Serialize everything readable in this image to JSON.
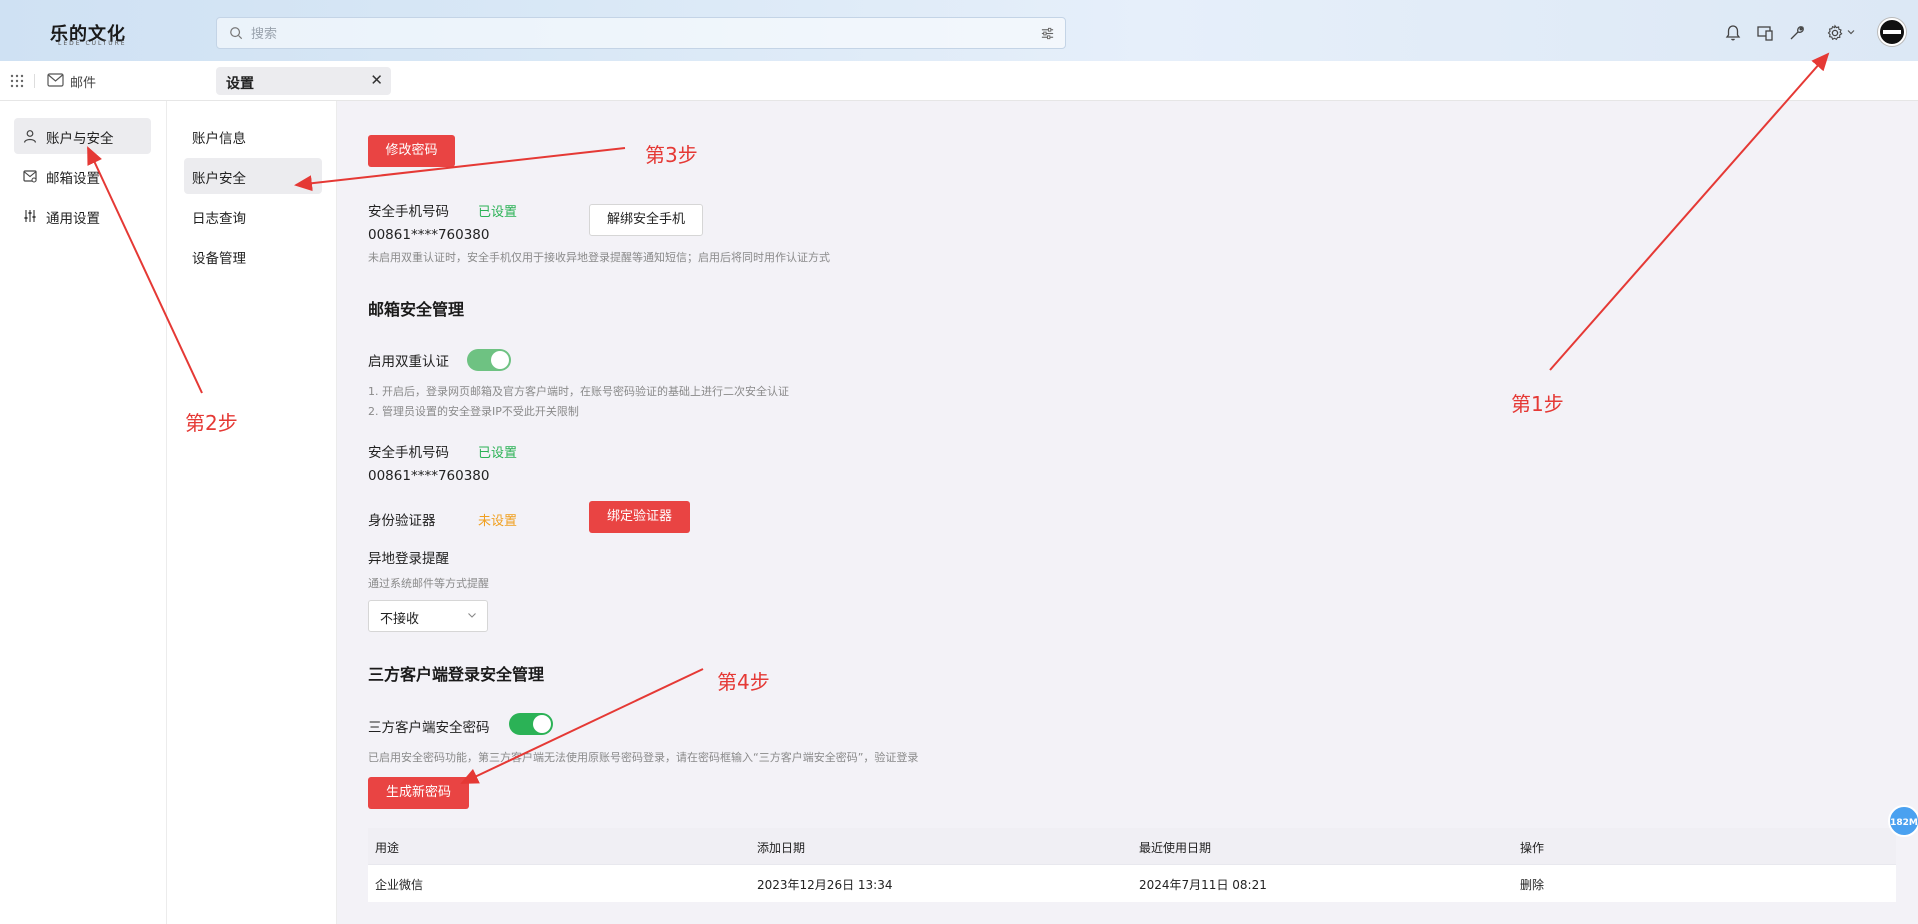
{
  "header": {
    "logo": "乐的文化",
    "logo_sub": "LEDE CULTURE",
    "search_placeholder": "搜索",
    "icons": [
      "bell-icon",
      "devices-icon",
      "wrench-icon",
      "gear-icon",
      "avatar"
    ]
  },
  "tabrow": {
    "app_label": "邮件",
    "active_tab": "设置"
  },
  "nav_primary": [
    {
      "label": "账户与安全",
      "icon": "user-icon",
      "active": true
    },
    {
      "label": "邮箱设置",
      "icon": "mailbox-icon",
      "active": false
    },
    {
      "label": "通用设置",
      "icon": "sliders-icon",
      "active": false
    }
  ],
  "nav_secondary": [
    {
      "label": "账户信息",
      "active": false
    },
    {
      "label": "账户安全",
      "active": true
    },
    {
      "label": "日志查询",
      "active": false
    },
    {
      "label": "设备管理",
      "active": false
    }
  ],
  "main": {
    "change_password_btn": "修改密码",
    "sec_phone_label": "安全手机号码",
    "sec_phone_status": "已设置",
    "sec_phone_number": "00861****760380",
    "unbind_phone_btn": "解绑安全手机",
    "sec_phone_hint": "未启用双重认证时，安全手机仅用于接收异地登录提醒等通知短信；启用后将同时用作认证方式",
    "mail_security_title": "邮箱安全管理",
    "two_factor_label": "启用双重认证",
    "two_factor_on": true,
    "two_factor_hint1": "1. 开启后，登录网页邮箱及官方客户端时，在账号密码验证的基础上进行二次安全认证",
    "two_factor_hint2": "2. 管理员设置的安全登录IP不受此开关限制",
    "sec_phone_label2": "安全手机号码",
    "sec_phone_status2": "已设置",
    "sec_phone_number2": "00861****760380",
    "authenticator_label": "身份验证器",
    "authenticator_status": "未设置",
    "bind_authenticator_btn": "绑定验证器",
    "remote_login_label": "异地登录提醒",
    "remote_login_hint": "通过系统邮件等方式提醒",
    "remote_login_value": "不接收",
    "third_party_title": "三方客户端登录安全管理",
    "third_party_pwd_label": "三方客户端安全密码",
    "third_party_pwd_on": true,
    "third_party_hint": "已启用安全密码功能，第三方客户端无法使用原账号密码登录，请在密码框输入“三方客户端安全密码”，验证登录",
    "generate_pwd_btn": "生成新密码",
    "table": {
      "headers": [
        "用途",
        "添加日期",
        "最近使用日期",
        "操作"
      ],
      "rows": [
        {
          "purpose": "企业微信",
          "added": "2023年12月26日 13:34",
          "last_used": "2024年7月11日 08:21",
          "action": "删除"
        }
      ]
    }
  },
  "fab_label": "182M",
  "annotations": {
    "step1": "第1步",
    "step2": "第2步",
    "step3": "第3步",
    "step4": "第4步"
  },
  "colors": {
    "accent_red": "#e94443",
    "ok_green": "#2bb256",
    "warn_orange": "#f0a020",
    "link_blue": "#2a7fd4",
    "annotation_red": "#e53935"
  }
}
